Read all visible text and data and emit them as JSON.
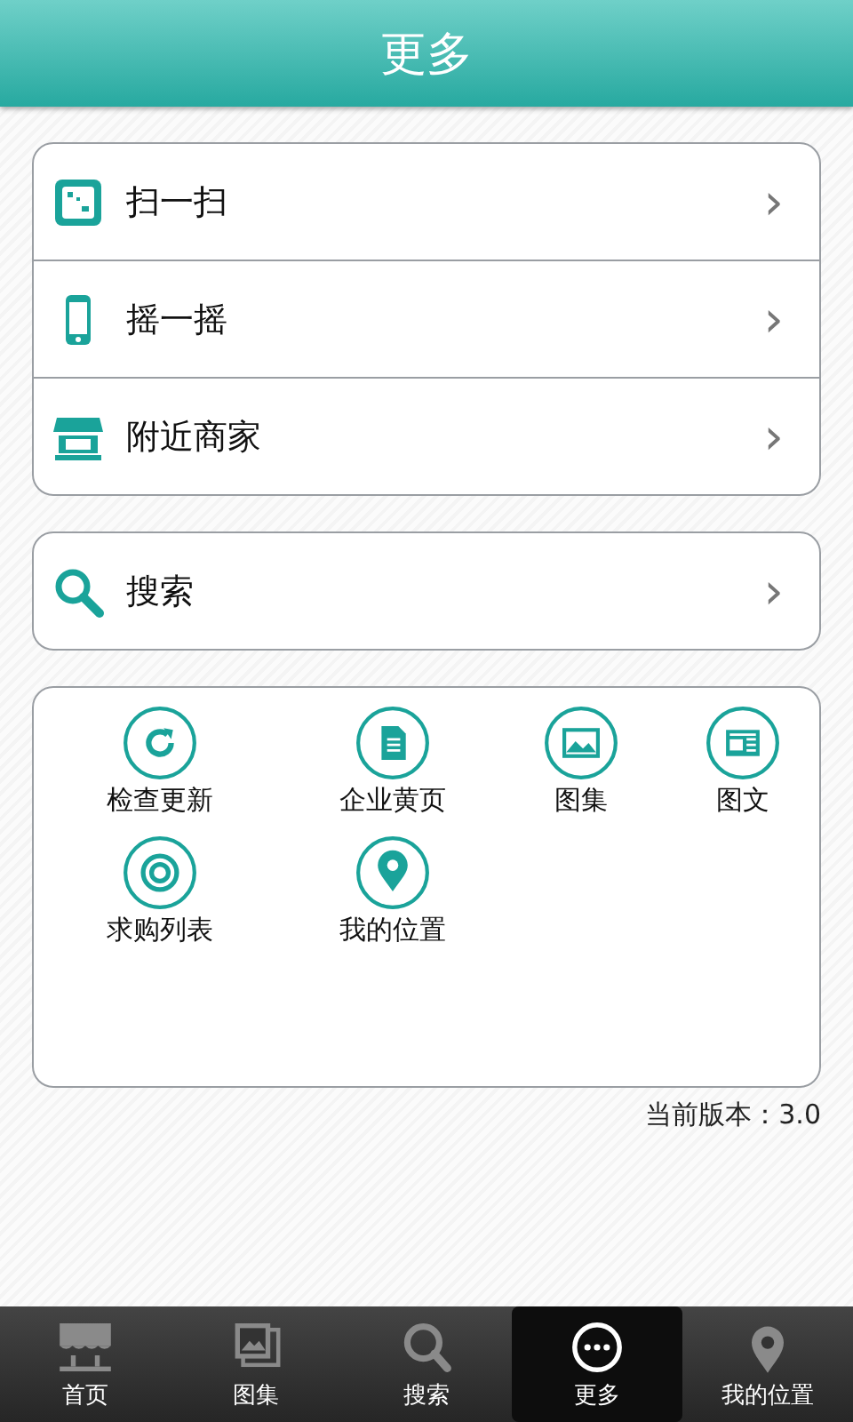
{
  "header": {
    "title": "更多"
  },
  "menu_groups": [
    {
      "items": [
        {
          "label": "扫一扫",
          "chevron": "›"
        },
        {
          "label": "摇一摇",
          "chevron": "›"
        },
        {
          "label": "附近商家",
          "chevron": "›"
        }
      ]
    },
    {
      "items": [
        {
          "label": "搜索",
          "chevron": "›"
        }
      ]
    }
  ],
  "tools": [
    {
      "label": "检查更新"
    },
    {
      "label": "企业黄页"
    },
    {
      "label": "图集"
    },
    {
      "label": "图文"
    },
    {
      "label": "求购列表"
    },
    {
      "label": "我的位置"
    }
  ],
  "version": "当前版本：3.0",
  "tab_bar": [
    {
      "label": "首页",
      "selected": false
    },
    {
      "label": "图集",
      "selected": false
    },
    {
      "label": "搜索",
      "selected": false
    },
    {
      "label": "更多",
      "selected": true
    },
    {
      "label": "我的位置",
      "selected": false
    }
  ]
}
